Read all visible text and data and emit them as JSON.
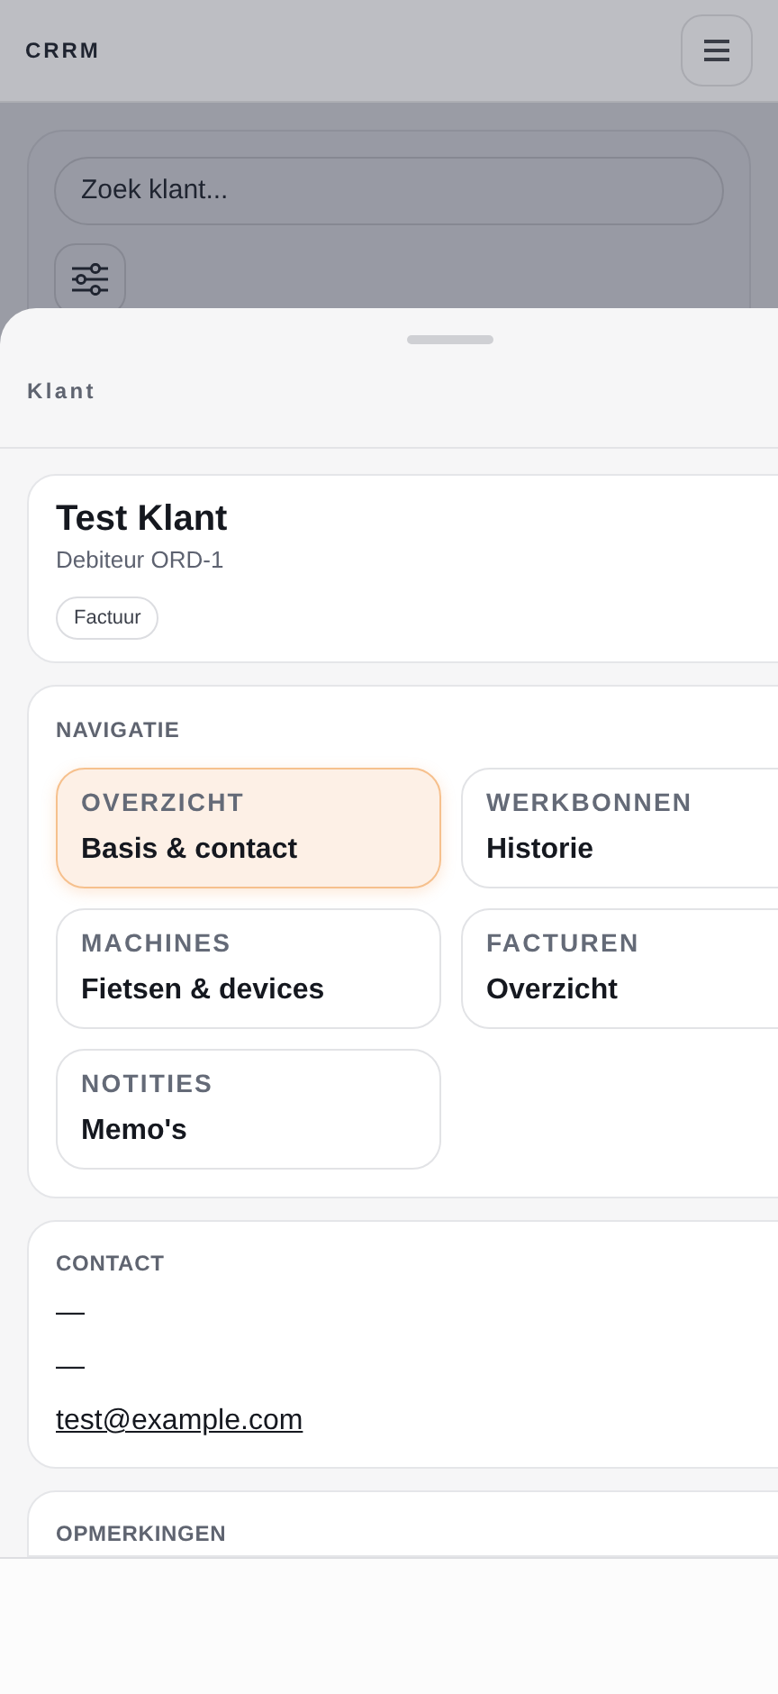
{
  "app_title": "CRRM",
  "search": {
    "placeholder": "Zoek klant..."
  },
  "sheet": {
    "title": "Klant"
  },
  "customer": {
    "name": "Test Klant",
    "subtitle": "Debiteur ORD-1",
    "tags": [
      "Factuur"
    ]
  },
  "navigation": {
    "heading": "NAVIGATIE",
    "items": [
      {
        "label": "OVERZICHT",
        "sublabel": "Basis & contact",
        "selected": true
      },
      {
        "label": "WERKBONNEN",
        "sublabel": "Historie",
        "selected": false
      },
      {
        "label": "MACHINES",
        "sublabel": "Fietsen & devices",
        "selected": false
      },
      {
        "label": "FACTUREN",
        "sublabel": "Overzicht",
        "selected": false
      },
      {
        "label": "NOTITIES",
        "sublabel": "Memo's",
        "selected": false
      }
    ]
  },
  "contact": {
    "heading": "CONTACT",
    "lines": [
      {
        "kind": "text",
        "text": "—"
      },
      {
        "kind": "text",
        "text": "—"
      },
      {
        "kind": "link",
        "text": "test@example.com"
      }
    ]
  },
  "remarks": {
    "heading": "OPMERKINGEN"
  }
}
